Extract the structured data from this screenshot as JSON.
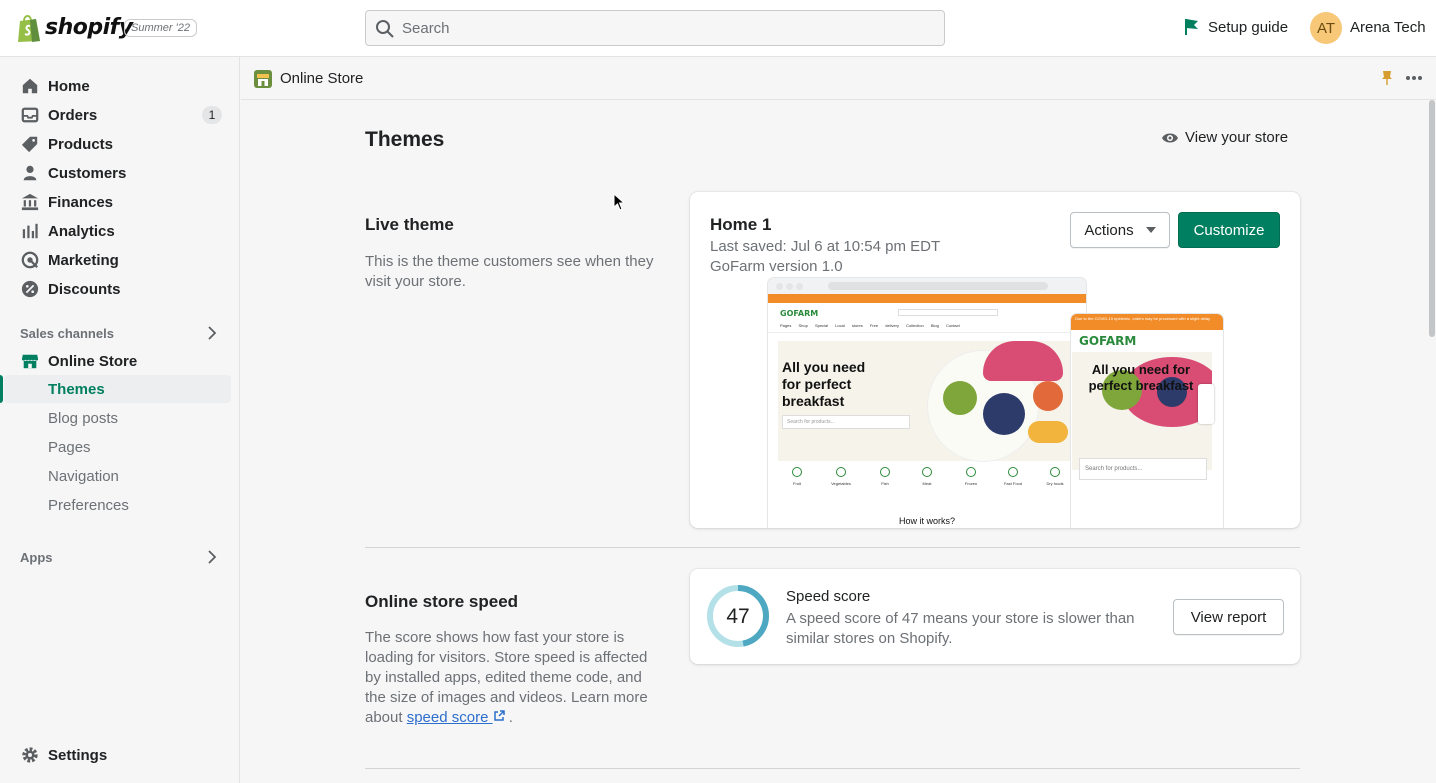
{
  "topbar": {
    "brand": "shopify",
    "edition": "Summer '22",
    "search_placeholder": "Search",
    "setup_guide": "Setup guide",
    "avatar_initials": "AT",
    "store_name": "Arena Tech",
    "accent": "#008060"
  },
  "sidebar": {
    "items": [
      {
        "label": "Home",
        "icon": "home-icon"
      },
      {
        "label": "Orders",
        "icon": "orders-icon",
        "badge": "1"
      },
      {
        "label": "Products",
        "icon": "tag-icon"
      },
      {
        "label": "Customers",
        "icon": "person-icon"
      },
      {
        "label": "Finances",
        "icon": "bank-icon"
      },
      {
        "label": "Analytics",
        "icon": "bar-chart-icon"
      },
      {
        "label": "Marketing",
        "icon": "target-icon"
      },
      {
        "label": "Discounts",
        "icon": "discount-icon"
      }
    ],
    "sales_channels": "Sales channels",
    "online_store": "Online Store",
    "sub_items": [
      "Themes",
      "Blog posts",
      "Pages",
      "Navigation",
      "Preferences"
    ],
    "apps": "Apps",
    "settings": "Settings"
  },
  "header": {
    "title": "Online Store"
  },
  "main": {
    "page_title": "Themes",
    "view_store": "View your store",
    "live_theme": {
      "title": "Live theme",
      "description": "This is the theme customers see when they visit your store.",
      "name": "Home 1",
      "last_saved": "Last saved: Jul 6 at 10:54 pm EDT",
      "version": "GoFarm version 1.0",
      "actions": "Actions",
      "customize": "Customize"
    },
    "preview": {
      "brand": "GOFARM",
      "hero": "All you need for perfect breakfast",
      "search": "Search for products...",
      "how": "How it works?",
      "categories": [
        "Fruit",
        "Vegetables",
        "Fish",
        "Meat",
        "Frozen",
        "Fast Food",
        "Dry foods"
      ],
      "mobile_banner": "Due to the COVID-19 epidemic, orders may be processed with a slight delay",
      "nav": [
        "Pages",
        "Shop",
        "Special",
        "Local stores",
        "Free delivery",
        "Collection",
        "Blog",
        "Contact"
      ]
    },
    "speed": {
      "title": "Online store speed",
      "description_1": "The score shows how fast your store is loading for visitors. Store speed is affected by installed apps, edited theme code, and the size of images and videos. Learn more about",
      "link": "speed score",
      "description_2": ".",
      "score": "47",
      "score_value": 47,
      "card_title": "Speed score",
      "card_desc": "A speed score of 47 means your store is slower than similar stores on Shopify.",
      "view_report": "View report"
    }
  }
}
